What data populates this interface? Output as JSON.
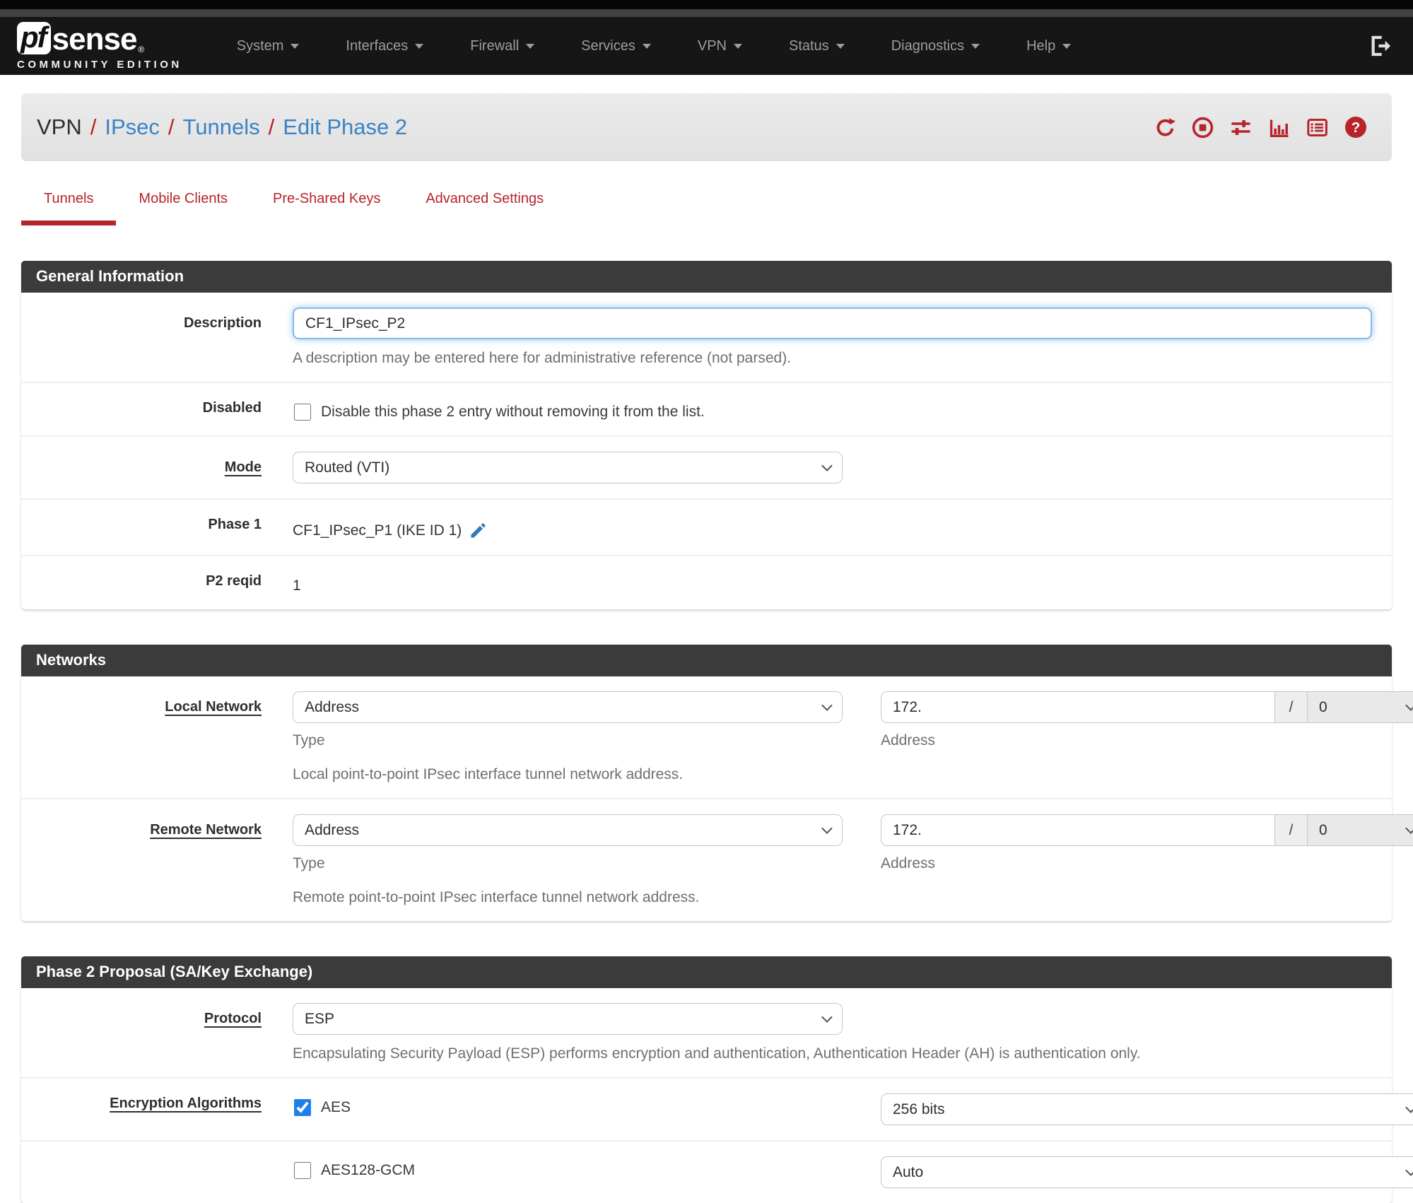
{
  "colors": {
    "accent_red": "#b7242a",
    "link_blue": "#3a83c6",
    "navbar_bg": "#161616",
    "panel_header_bg": "#3b3b3b",
    "checkbox_blue": "#1e80e8"
  },
  "navbar": {
    "brand": {
      "pf": "pf",
      "sense": "sense",
      "reg": "®",
      "edition": "COMMUNITY EDITION"
    },
    "items": [
      {
        "label": "System"
      },
      {
        "label": "Interfaces"
      },
      {
        "label": "Firewall"
      },
      {
        "label": "Services"
      },
      {
        "label": "VPN"
      },
      {
        "label": "Status"
      },
      {
        "label": "Diagnostics"
      },
      {
        "label": "Help"
      }
    ]
  },
  "breadcrumb": {
    "root": "VPN",
    "sep": "/",
    "link1": "IPsec",
    "link2": "Tunnels",
    "link3": "Edit Phase 2"
  },
  "tabs": [
    {
      "label": "Tunnels",
      "active": true
    },
    {
      "label": "Mobile Clients",
      "active": false
    },
    {
      "label": "Pre-Shared Keys",
      "active": false
    },
    {
      "label": "Advanced Settings",
      "active": false
    }
  ],
  "general": {
    "title": "General Information",
    "description": {
      "label": "Description",
      "value": "CF1_IPsec_P2",
      "help": "A description may be entered here for administrative reference (not parsed)."
    },
    "disabled": {
      "label": "Disabled",
      "checkbox_label": "Disable this phase 2 entry without removing it from the list."
    },
    "mode": {
      "label": "Mode",
      "value": "Routed (VTI)"
    },
    "phase1": {
      "label": "Phase 1",
      "value": "CF1_IPsec_P1 (IKE ID 1)"
    },
    "reqid": {
      "label": "P2 reqid",
      "value": "1"
    }
  },
  "networks": {
    "title": "Networks",
    "local": {
      "label": "Local Network",
      "type_value": "Address",
      "type_caption": "Type",
      "address_value": "172.",
      "address_caption": "Address",
      "mask_sep": "/",
      "mask_value": "0",
      "help": "Local point-to-point IPsec interface tunnel network address."
    },
    "remote": {
      "label": "Remote Network",
      "type_value": "Address",
      "type_caption": "Type",
      "address_value": "172.",
      "address_caption": "Address",
      "mask_sep": "/",
      "mask_value": "0",
      "help": "Remote point-to-point IPsec interface tunnel network address."
    }
  },
  "proposal": {
    "title": "Phase 2 Proposal (SA/Key Exchange)",
    "protocol": {
      "label": "Protocol",
      "value": "ESP",
      "help": "Encapsulating Security Payload (ESP) performs encryption and authentication, Authentication Header (AH) is authentication only."
    },
    "encryption": {
      "label": "Encryption Algorithms",
      "algorithms": [
        {
          "name": "AES",
          "checked": "checked",
          "keylen": "256 bits"
        },
        {
          "name": "AES128-GCM",
          "keylen": "Auto"
        }
      ]
    }
  }
}
